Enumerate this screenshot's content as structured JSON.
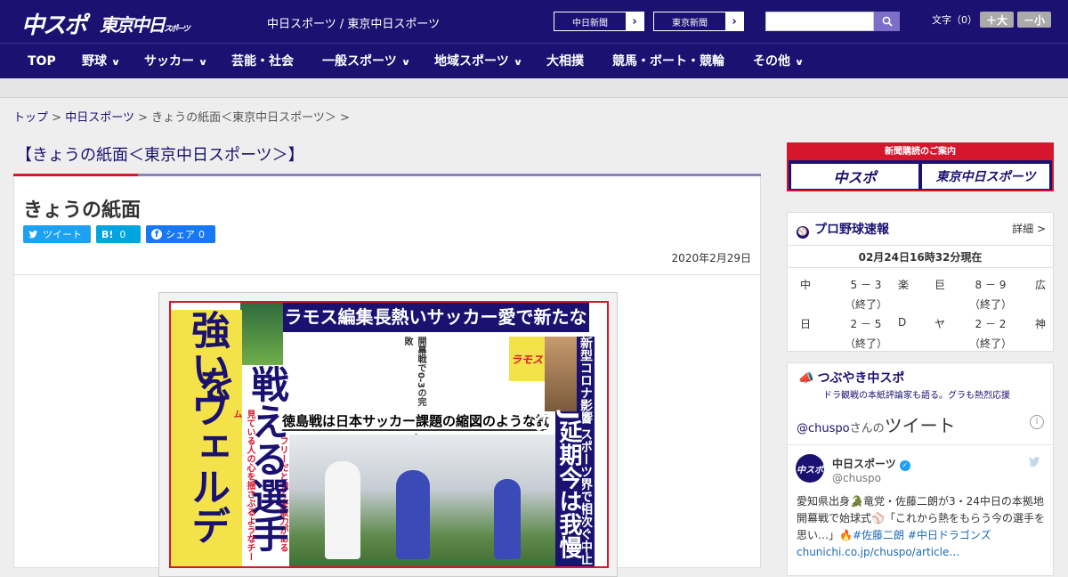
{
  "header": {
    "logo_chuspo": "中スポ",
    "logo_tokyo": "東京中日",
    "logo_tokyo_small": "スポーツ",
    "tagline": "中日スポーツ / 東京中日スポーツ",
    "paper_buttons": [
      "中日新聞",
      "東京新聞"
    ],
    "search": {
      "placeholder": "",
      "button_icon": "search-icon"
    },
    "font_label": "文字（0）",
    "font_bigger": "＋大",
    "font_smaller": "－小"
  },
  "nav": {
    "items": [
      {
        "label": "TOP",
        "chevron": false
      },
      {
        "label": "野球",
        "chevron": true
      },
      {
        "label": "サッカー",
        "chevron": true
      },
      {
        "label": "芸能・社会",
        "chevron": false
      },
      {
        "label": "一般スポーツ",
        "chevron": true
      },
      {
        "label": "地域スポーツ",
        "chevron": true
      },
      {
        "label": "大相撲",
        "chevron": false
      },
      {
        "label": "競馬・ボート・競輪",
        "chevron": false
      },
      {
        "label": "その他",
        "chevron": true
      }
    ]
  },
  "breadcrumb": {
    "items": [
      "トップ",
      "中日スポーツ",
      "きょうの紙面＜東京中日スポーツ＞"
    ],
    "separator": ">"
  },
  "page_title": "【きょうの紙面＜東京中日スポーツ＞】",
  "article": {
    "title": "きょうの紙面",
    "share": {
      "tweet": "ツイート",
      "hatena_label": "B!",
      "hatena_count": "0",
      "facebook": "シェア",
      "facebook_count": "0"
    },
    "date": "2020年2月29日",
    "paper": {
      "headline_bar": "ラモス編集長熱いサッカー愛で新たな挑戦",
      "big_left": "強いヴェルディを",
      "big_mid": "戦える選手を",
      "right_big": "J延期今は我慢の",
      "right_side": "新型コロナ影響 スポーツ界で相次ぐ中止",
      "subhead": "徳島戦は日本サッカー課題の縮図のような試合",
      "small_tag": "ラモス",
      "col_a": "開幕戦で0-3の完敗",
      "col_b": "見ている人の心を揺さぶるようなチーム",
      "col_c": "フリーだと強く突破力がある"
    }
  },
  "sidebar": {
    "ad": {
      "top": "新聞購読のご案内",
      "left": "中スポ",
      "right": "東京中日スポーツ"
    },
    "baseball": {
      "title": "プロ野球速報",
      "detail": "詳細 >",
      "updated": "02月24日16時32分現在",
      "games": [
        {
          "home": "中",
          "score": "5 － 3",
          "away": "楽",
          "status": "（終了）"
        },
        {
          "home": "巨",
          "score": "8 － 9",
          "away": "広",
          "status": "（終了）"
        },
        {
          "home": "日",
          "score": "2 － 5",
          "away": "D",
          "status": "（終了）"
        },
        {
          "home": "ヤ",
          "score": "2 － 2",
          "away": "神",
          "status": "（終了）"
        }
      ]
    },
    "tweets": {
      "title": "つぶやき中スポ",
      "subtitle": "ドラ観戦の本紙評論家も語る。グラも熱烈応援",
      "handle_link": "@chuspo",
      "handle_suffix": "さんの",
      "heading": "ツイート",
      "account_name": "中日スポーツ",
      "account_handle": "@chuspo",
      "avatar_text": "中スポ",
      "text": "愛知県出身🐊竜党・佐藤二朗が3・24中日の本拠地開幕戦で始球式⚾「これから熱をもらう今の選手を思い…」🔥",
      "hashtags": "#佐藤二朗 #中日ドラゴンズ",
      "link": "chunichi.co.jp/chuspo/article…"
    }
  },
  "colors": {
    "brand": "#1b1170",
    "accent_red": "#d6162c",
    "twitter": "#1da1f2",
    "hatena": "#00a4de",
    "facebook": "#1877f2"
  }
}
